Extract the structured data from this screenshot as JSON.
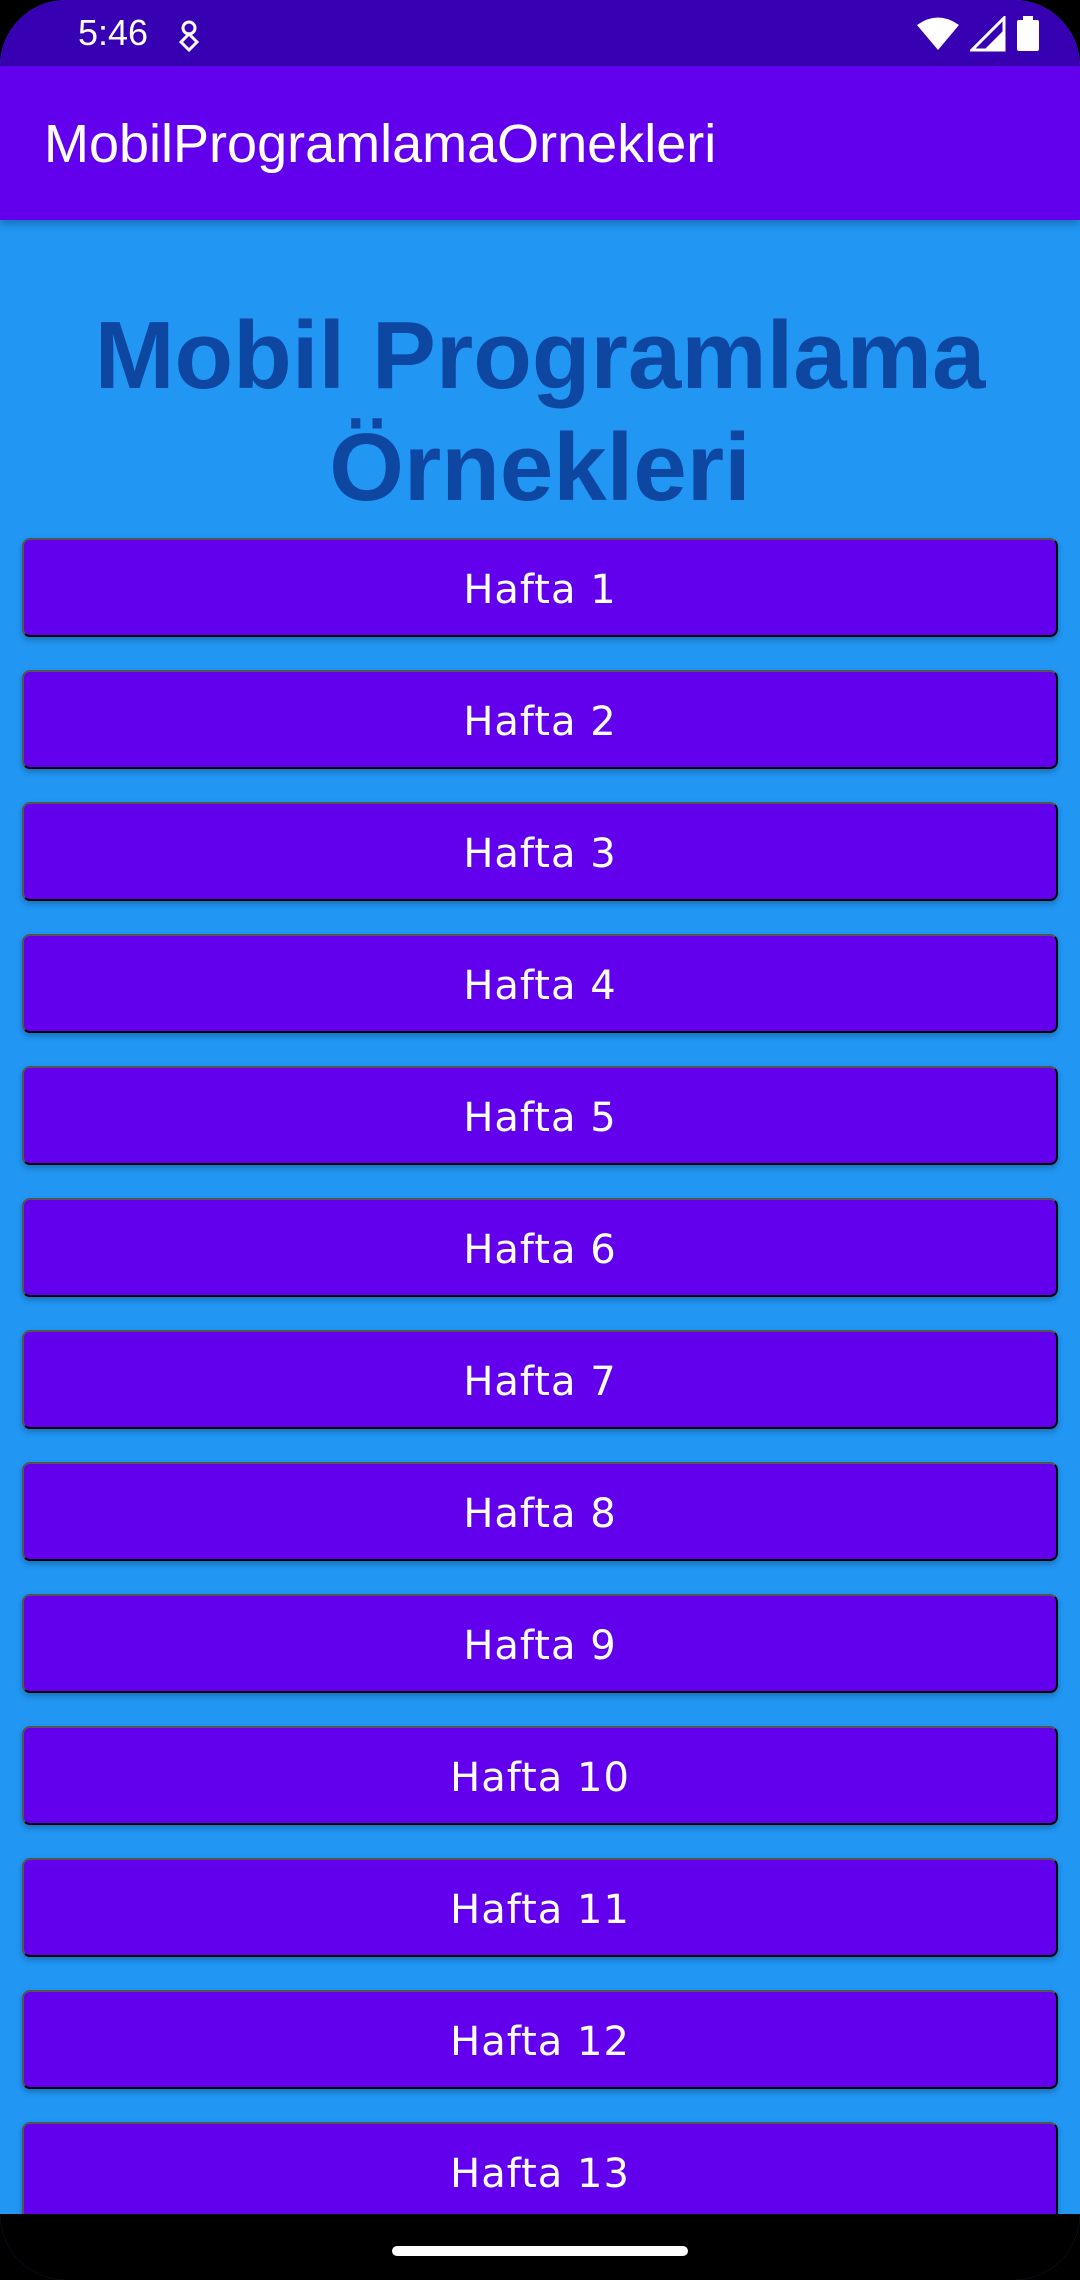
{
  "status_bar": {
    "time": "5:46",
    "notification_icon": "location-pin-icon",
    "icons": [
      "wifi-icon",
      "signal-icon",
      "battery-icon"
    ],
    "color": "#3700B3"
  },
  "app_bar": {
    "title": "MobilProgramlamaOrnekleri",
    "color": "#6200EE"
  },
  "main": {
    "heading": "Mobil Programlama Örnekleri",
    "background_color": "#2196F3",
    "heading_color": "#0D47A1",
    "weeks": [
      {
        "label": "Hafta 1"
      },
      {
        "label": "Hafta 2"
      },
      {
        "label": "Hafta 3"
      },
      {
        "label": "Hafta 4"
      },
      {
        "label": "Hafta 5"
      },
      {
        "label": "Hafta 6"
      },
      {
        "label": "Hafta 7"
      },
      {
        "label": "Hafta 8"
      },
      {
        "label": "Hafta 9"
      },
      {
        "label": "Hafta 10"
      },
      {
        "label": "Hafta 11"
      },
      {
        "label": "Hafta 12"
      },
      {
        "label": "Hafta 13"
      }
    ]
  }
}
